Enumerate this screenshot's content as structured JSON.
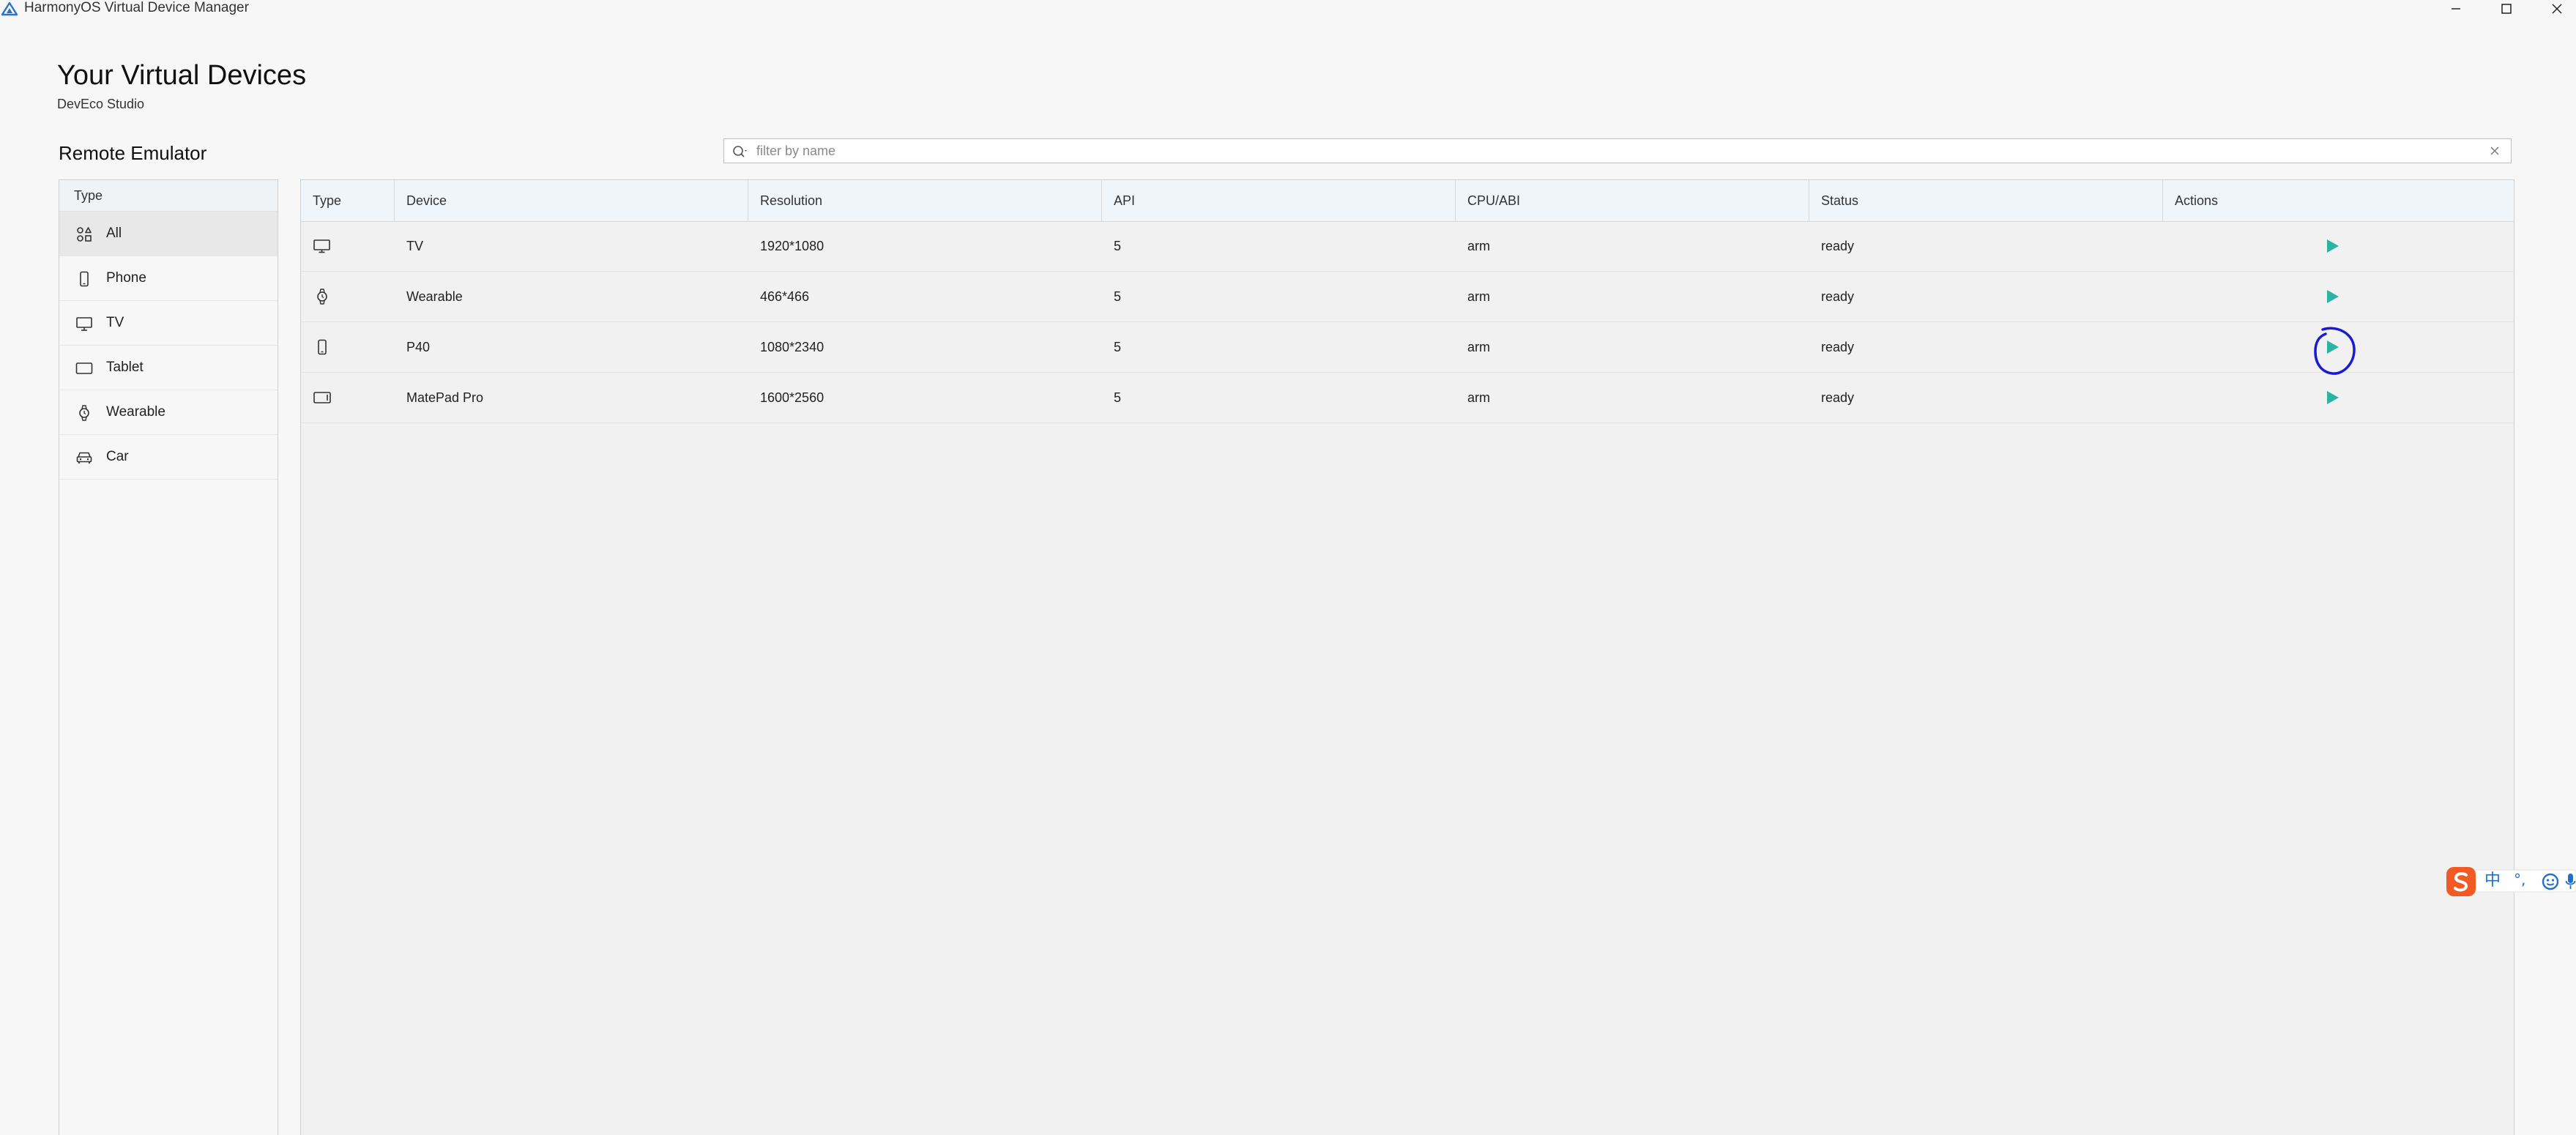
{
  "window": {
    "title": "HarmonyOS Virtual Device Manager",
    "controls": [
      "minimize",
      "maximize",
      "close"
    ]
  },
  "header": {
    "title": "Your Virtual Devices",
    "subtitle": "DevEco Studio"
  },
  "section_title": "Remote Emulator",
  "search": {
    "placeholder": "filter by name",
    "value": ""
  },
  "sidebar": {
    "header": "Type",
    "selected": "All",
    "items": [
      {
        "label": "All",
        "icon": "all-icon"
      },
      {
        "label": "Phone",
        "icon": "phone-icon"
      },
      {
        "label": "TV",
        "icon": "tv-icon"
      },
      {
        "label": "Tablet",
        "icon": "tablet-icon"
      },
      {
        "label": "Wearable",
        "icon": "watch-icon"
      },
      {
        "label": "Car",
        "icon": "car-icon"
      }
    ]
  },
  "table": {
    "columns": [
      "Type",
      "Device",
      "Resolution",
      "API",
      "CPU/ABI",
      "Status",
      "Actions"
    ],
    "rows": [
      {
        "type_icon": "tv-icon",
        "device": "TV",
        "resolution": "1920*1080",
        "api": "5",
        "cpu": "arm",
        "status": "ready",
        "action": "play-icon"
      },
      {
        "type_icon": "watch-icon",
        "device": "Wearable",
        "resolution": "466*466",
        "api": "5",
        "cpu": "arm",
        "status": "ready",
        "action": "play-icon"
      },
      {
        "type_icon": "phone-icon",
        "device": "P40",
        "resolution": "1080*2340",
        "api": "5",
        "cpu": "arm",
        "status": "ready",
        "action": "play-icon"
      },
      {
        "type_icon": "tablet-icon",
        "device": "MatePad Pro",
        "resolution": "1600*2560",
        "api": "5",
        "cpu": "arm",
        "status": "ready",
        "action": "play-icon"
      }
    ]
  },
  "ime_toolbar": {
    "mode_label": "中",
    "punct_label": "°,",
    "icons": [
      "sogou-logo-icon",
      "emoji-icon",
      "microphone-icon"
    ]
  },
  "colors": {
    "play": "#2bb3a3",
    "annotation": "#1a1ad6",
    "ime_brand": "#f15a24",
    "ime_icons": "#1f6fd1"
  }
}
